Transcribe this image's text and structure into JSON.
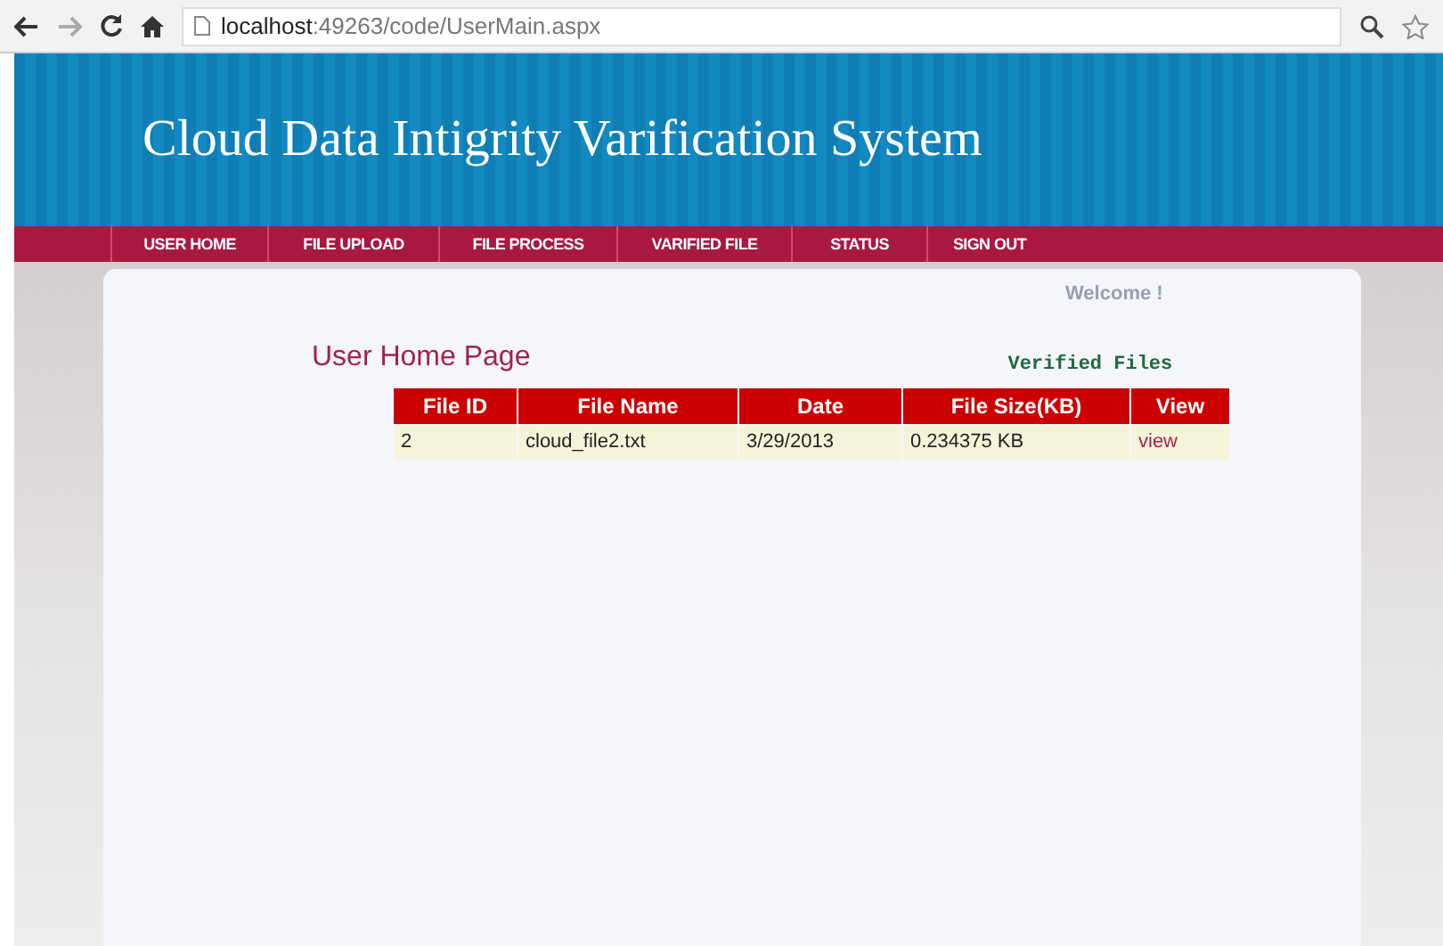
{
  "browser": {
    "url_host": "localhost",
    "url_rest": ":49263/code/UserMain.aspx"
  },
  "header": {
    "title": "Cloud Data Intigrity Varification System"
  },
  "nav": [
    {
      "label": "USER HOME"
    },
    {
      "label": "FILE UPLOAD"
    },
    {
      "label": "FILE PROCESS"
    },
    {
      "label": "VARIFIED FILE"
    },
    {
      "label": "STATUS"
    },
    {
      "label": "SIGN OUT"
    }
  ],
  "welcome": "Welcome !",
  "page_title": "User Home Page",
  "table_caption": "Verified Files",
  "table": {
    "columns": [
      "File ID",
      "File Name",
      "Date",
      "File Size(KB)",
      "View"
    ],
    "rows": [
      {
        "cells": [
          "2",
          "cloud_file2.txt",
          "3/29/2013",
          "0.234375 KB"
        ],
        "link": "view"
      }
    ]
  }
}
